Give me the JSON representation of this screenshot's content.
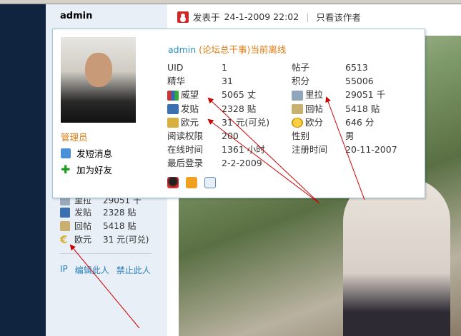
{
  "post": {
    "author": "admin",
    "posted_prefix": "发表于",
    "posted_time": "24-1-2009 22:02",
    "only_author": "只看该作者"
  },
  "sidebar": {
    "stats": [
      {
        "label": "里拉",
        "value": "29051 千",
        "icon": "pound-icon"
      },
      {
        "label": "发贴",
        "value": "2328 贴",
        "icon": "book-icon"
      },
      {
        "label": "回帖",
        "value": "5418 贴",
        "icon": "edit-icon"
      },
      {
        "label": "欧元",
        "value": "31 元(可兑)",
        "icon": "euro-icon"
      }
    ],
    "links": [
      "IP",
      "编辑此人",
      "禁止此人"
    ]
  },
  "popup": {
    "username": "admin",
    "title_suffix": "(论坛总干事)当前离线",
    "role": "管理员",
    "actions": [
      "发短消息",
      "加为好友"
    ],
    "fields": [
      {
        "label": "UID",
        "value": "1"
      },
      {
        "label": "帖子",
        "value": "6513"
      },
      {
        "label": "精华",
        "value": "31"
      },
      {
        "label": "积分",
        "value": "55006"
      },
      {
        "label": "威望",
        "value": "5065 丈",
        "icon": "chart-icon"
      },
      {
        "label": "里拉",
        "value": "29051 千",
        "icon": "pound-icon"
      },
      {
        "label": "发贴",
        "value": "2328 贴",
        "icon": "book-icon"
      },
      {
        "label": "回帖",
        "value": "5418 贴",
        "icon": "edit-icon"
      },
      {
        "label": "欧元",
        "value": "31 元(可兑)",
        "icon": "euro-icon"
      },
      {
        "label": "欧分",
        "value": "646 分",
        "icon": "coin-icon"
      },
      {
        "label": "阅读权限",
        "value": "200"
      },
      {
        "label": "性别",
        "value": "男"
      },
      {
        "label": "在线时间",
        "value": "1361 小时"
      },
      {
        "label": "注册时间",
        "value": "20-11-2007"
      },
      {
        "label": "最后登录",
        "value": "2-2-2009"
      }
    ]
  },
  "colors": {
    "accent": "#2a8fb8",
    "orange": "#e07a10",
    "arrow": "#cc0000"
  }
}
